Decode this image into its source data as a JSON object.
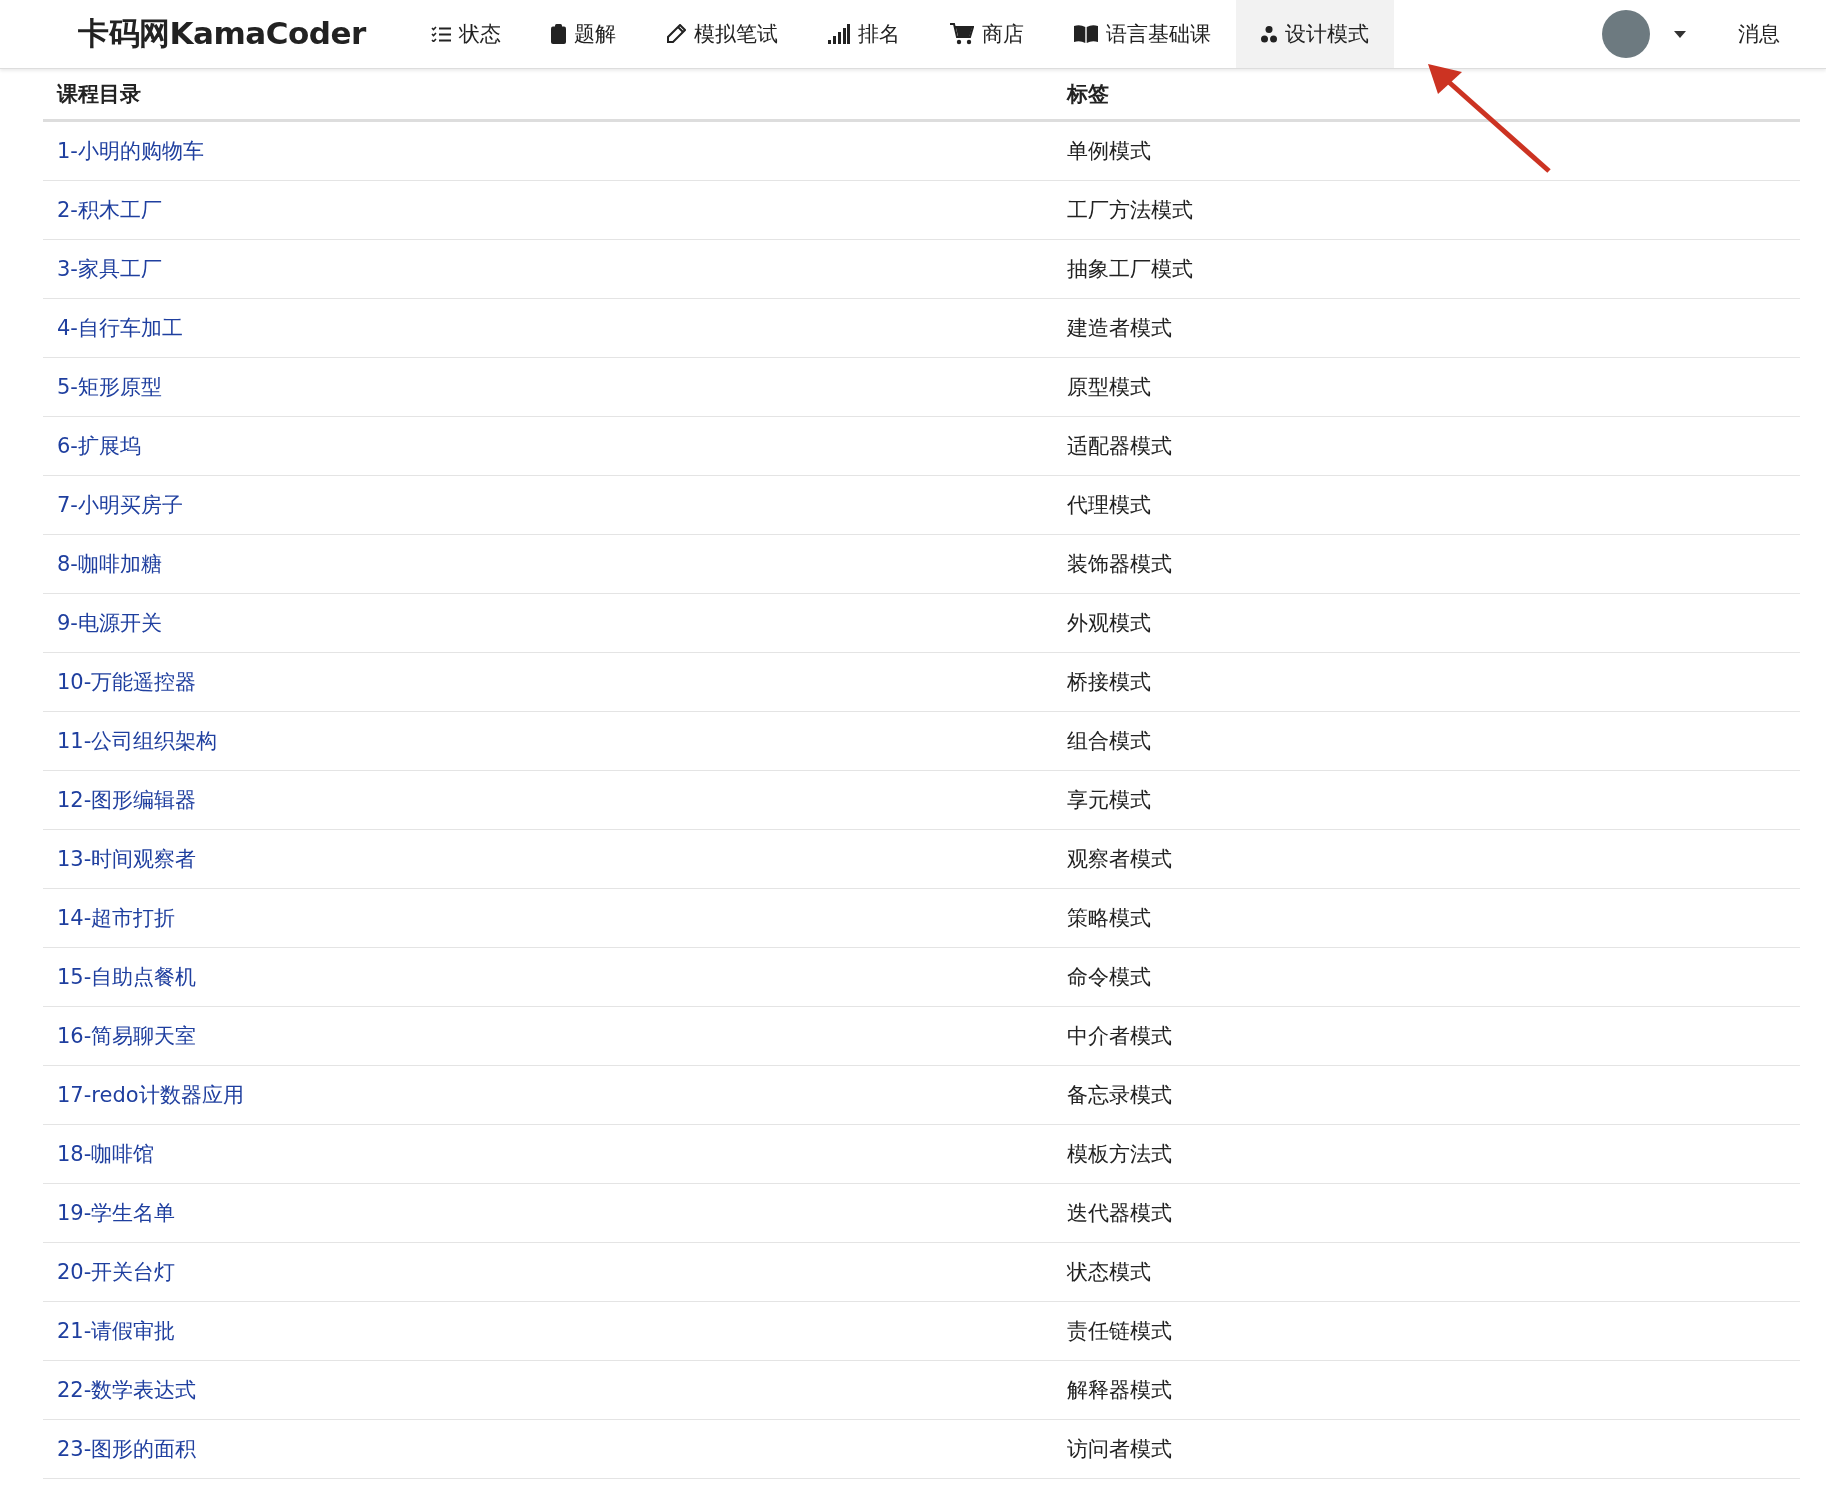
{
  "logo": "卡码网KamaCoder",
  "nav": [
    {
      "label": "状态",
      "selected": false
    },
    {
      "label": "题解",
      "selected": false
    },
    {
      "label": "模拟笔试",
      "selected": false
    },
    {
      "label": "排名",
      "selected": false
    },
    {
      "label": "商店",
      "selected": false
    },
    {
      "label": "语言基础课",
      "selected": false
    },
    {
      "label": "设计模式",
      "selected": true
    }
  ],
  "messages": "消息",
  "table": {
    "columns": [
      "课程目录",
      "标签"
    ],
    "rows": [
      [
        "1-小明的购物车",
        "单例模式"
      ],
      [
        "2-积木工厂",
        "工厂方法模式"
      ],
      [
        "3-家具工厂",
        "抽象工厂模式"
      ],
      [
        "4-自行车加工",
        "建造者模式"
      ],
      [
        "5-矩形原型",
        "原型模式"
      ],
      [
        "6-扩展坞",
        "适配器模式"
      ],
      [
        "7-小明买房子",
        "代理模式"
      ],
      [
        "8-咖啡加糖",
        "装饰器模式"
      ],
      [
        "9-电源开关",
        "外观模式"
      ],
      [
        "10-万能遥控器",
        "桥接模式"
      ],
      [
        "11-公司组织架构",
        "组合模式"
      ],
      [
        "12-图形编辑器",
        "享元模式"
      ],
      [
        "13-时间观察者",
        "观察者模式"
      ],
      [
        "14-超市打折",
        "策略模式"
      ],
      [
        "15-自助点餐机",
        "命令模式"
      ],
      [
        "16-简易聊天室",
        "中介者模式"
      ],
      [
        "17-redo计数器应用",
        "备忘录模式"
      ],
      [
        "18-咖啡馆",
        "模板方法式"
      ],
      [
        "19-学生名单",
        "迭代器模式"
      ],
      [
        "20-开关台灯",
        "状态模式"
      ],
      [
        "21-请假审批",
        "责任链模式"
      ],
      [
        "22-数学表达式",
        "解释器模式"
      ],
      [
        "23-图形的面积",
        "访问者模式"
      ]
    ]
  }
}
